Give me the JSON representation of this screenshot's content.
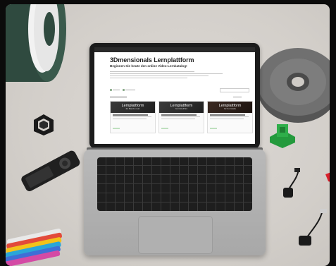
{
  "website": {
    "nav_items": [
      "",
      "",
      "",
      "",
      "",
      "",
      "",
      "",
      ""
    ],
    "title": "3Dmensionals Lernplattform",
    "subtitle": "Beginnen Sie heute den online Video-Lernkatalog!",
    "cards": [
      {
        "heading": "Lernplattform",
        "caption": "für Bambu Lab"
      },
      {
        "heading": "Lernplattform",
        "caption": "für OctoPrint"
      },
      {
        "heading": "Lernplattform",
        "caption": "für Formlabs"
      }
    ]
  },
  "colors": {
    "spool_dark_green": "#2f4a3f",
    "spool_grey": "#6e6e6e",
    "print_green": "#2fae4a",
    "laptop_silver": "#b5b5b5"
  }
}
